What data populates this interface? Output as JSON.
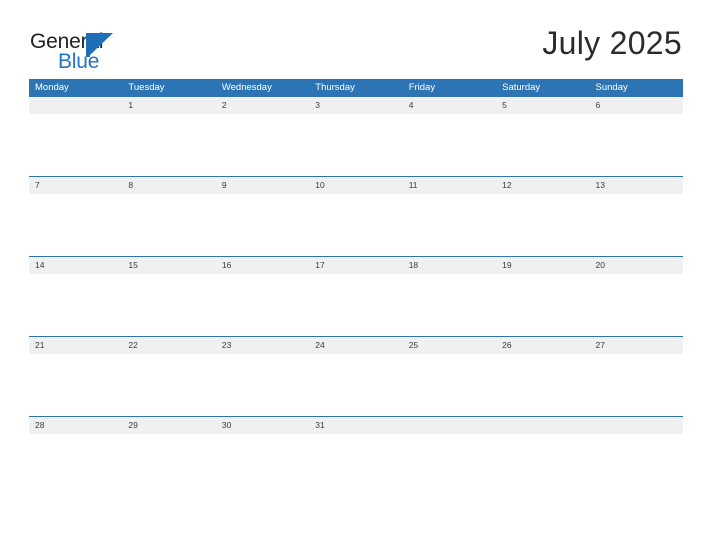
{
  "brand": {
    "name_top": "General",
    "name_bottom": "Blue",
    "mark": "triangle-flag",
    "color_dark": "#231f20",
    "color_blue": "#2175c4"
  },
  "header": {
    "title": "July 2025"
  },
  "theme": {
    "header_blue": "#2d74b5",
    "band_gray": "#f0f0f0",
    "rule_blue": "#2d74b5",
    "text_dark": "#3a3a3a",
    "page_background": "#ffffff"
  },
  "calendar": {
    "month": "July",
    "year": "2025",
    "week_start": "Monday",
    "weekday_headers": [
      "Monday",
      "Tuesday",
      "Wednesday",
      "Thursday",
      "Friday",
      "Saturday",
      "Sunday"
    ],
    "weeks": [
      {
        "days": [
          "",
          "1",
          "2",
          "3",
          "4",
          "5",
          "6"
        ]
      },
      {
        "days": [
          "7",
          "8",
          "9",
          "10",
          "11",
          "12",
          "13"
        ]
      },
      {
        "days": [
          "14",
          "15",
          "16",
          "17",
          "18",
          "19",
          "20"
        ]
      },
      {
        "days": [
          "21",
          "22",
          "23",
          "24",
          "25",
          "26",
          "27"
        ]
      },
      {
        "days": [
          "28",
          "29",
          "30",
          "31",
          "",
          "",
          ""
        ]
      }
    ]
  }
}
